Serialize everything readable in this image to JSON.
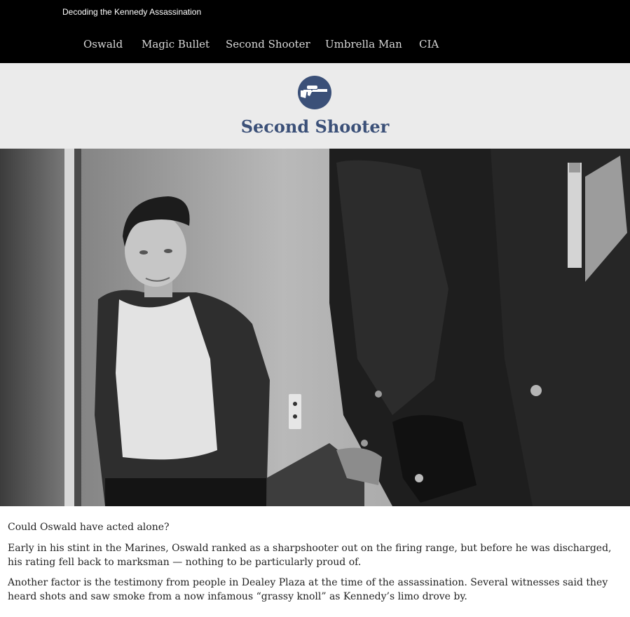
{
  "site": {
    "title": "Decoding the Kennedy Assassination"
  },
  "nav": {
    "items": [
      {
        "label": "Oswald"
      },
      {
        "label": "Magic Bullet"
      },
      {
        "label": "Second Shooter"
      },
      {
        "label": "Umbrella Man"
      },
      {
        "label": "CIA"
      }
    ]
  },
  "section": {
    "icon": "rifle-icon",
    "title": "Second Shooter"
  },
  "hero": {
    "image": "photo-oswald-in-custody-with-officers"
  },
  "article": {
    "paragraphs": [
      "Could Oswald have acted alone?",
      "Early in his stint in the Marines, Oswald ranked as a sharpshooter out on the firing range, but before he was discharged, his rating fell back to marksman — nothing to be particularly proud of.",
      "Another factor is the testimony from people in Dealey Plaza at the time of the assassination. Several witnesses said they heard shots and saw smoke from a now infamous “grassy knoll” as Kennedy’s limo drove by."
    ]
  },
  "colors": {
    "topbar": "#000000",
    "header_bg": "#ebebeb",
    "accent": "#3b5078",
    "body_text": "#222222",
    "nav_text": "#d9d9d9"
  }
}
